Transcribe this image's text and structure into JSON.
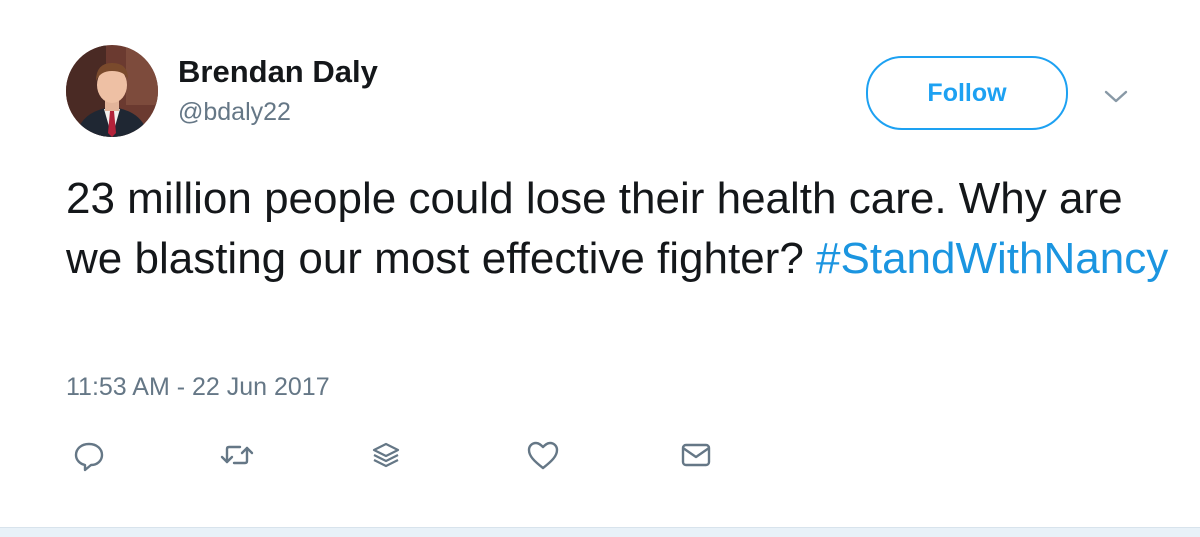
{
  "tweet": {
    "author": {
      "display_name": "Brendan Daly",
      "handle": "@bdaly22"
    },
    "follow_label": "Follow",
    "text_plain": "23 million people could lose their health care. Why are we blasting our most effective fighter? ",
    "hashtag": "#StandWithNancy",
    "timestamp": "11:53 AM - 22 Jun 2017",
    "actions": [
      {
        "icon": "reply-icon"
      },
      {
        "icon": "retweet-icon"
      },
      {
        "icon": "stack-icon"
      },
      {
        "icon": "like-icon"
      },
      {
        "icon": "direct-message-icon"
      }
    ]
  },
  "colors": {
    "accent": "#1da1f2",
    "hashtag": "#1b95e0",
    "text": "#14171a",
    "secondary_text": "#657786",
    "icon": "#657786"
  }
}
